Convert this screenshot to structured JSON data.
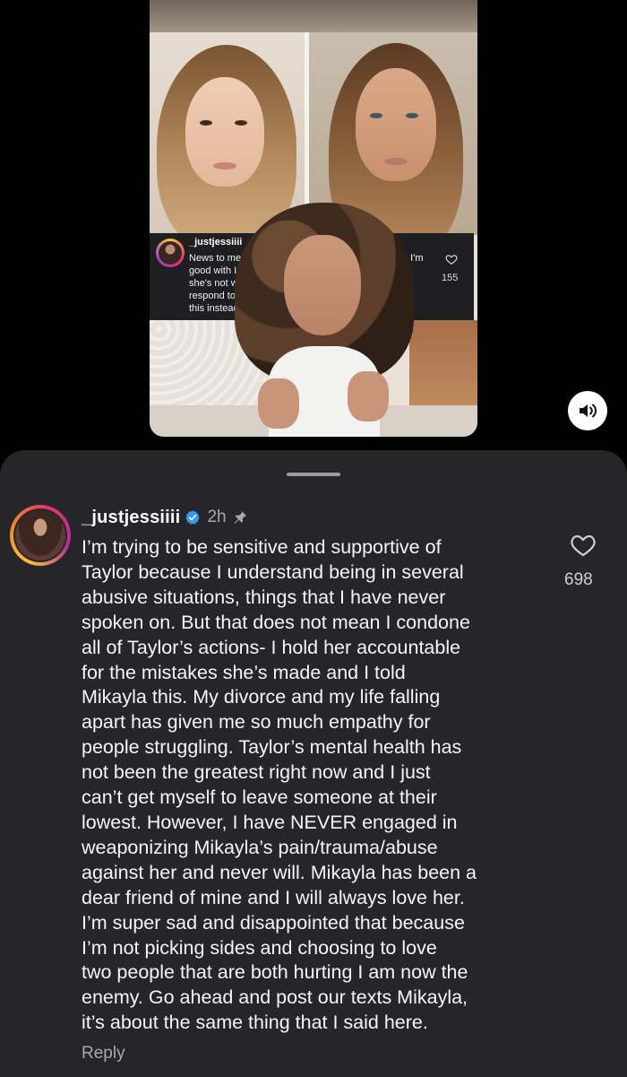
{
  "video": {
    "embedded_comment": {
      "username": "_justjessiiii",
      "lines": [
        "News to me",
        "good with I",
        "she's not w",
        "respond to",
        "this instead"
      ],
      "fragments": [
        "r. I'm",
        "c"
      ],
      "likes": "155"
    },
    "sound_icon": "speaker-icon"
  },
  "comment": {
    "username": "_justjessiiii",
    "time": "2h",
    "text": "I’m trying to be sensitive and supportive of\nTaylor because I understand being in several\nabusive situations, things that I have never\nspoken on. But that does not mean I condone\nall of Taylor’s actions- I hold her accountable\nfor the mistakes she’s made and I told\nMikayla this. My divorce and my life falling\napart has given me so much empathy for\npeople struggling. Taylor’s mental health has\nnot been the greatest right now and I just\ncan’t get myself to leave someone at their\nlowest. However, I have NEVER engaged in\nweaponizing Mikayla’s pain/trauma/abuse\nagainst her and never will. Mikayla has been a\ndear friend of mine and I will always love her.\nI’m super sad and disappointed that because\nI’m not picking sides and choosing to love\ntwo people that are both hurting I am now the\nenemy. Go ahead and post our texts Mikayla,\nit’s about the same thing that I said here.",
    "likes": "698",
    "reply_label": "Reply"
  },
  "colors": {
    "sheet_bg": "#262628",
    "verified_blue": "#3897f0",
    "secondary_text": "#a8a8a8"
  }
}
